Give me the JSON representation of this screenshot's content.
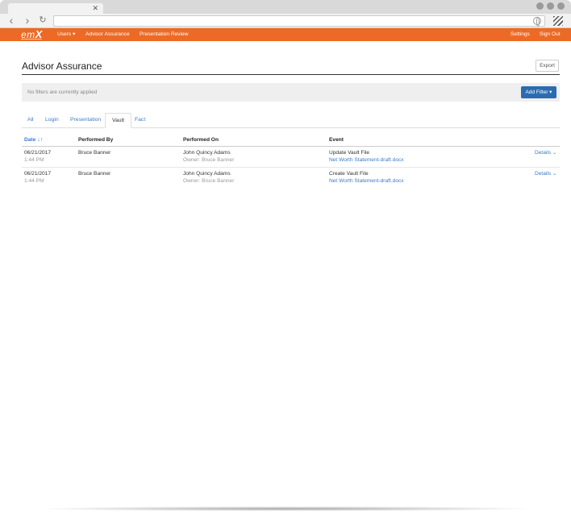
{
  "browser": {
    "tab_close": "✕",
    "url": ""
  },
  "header": {
    "logo_prefix": "em",
    "logo_suffix": "X",
    "nav": [
      {
        "label": "Users ▾"
      },
      {
        "label": "Advisor Assurance"
      },
      {
        "label": "Presentation Review"
      }
    ],
    "settings_label": "Settings",
    "signout_label": "Sign Out",
    "accent_color": "#ec6a25"
  },
  "page": {
    "title": "Advisor Assurance",
    "export_label": "Export"
  },
  "filters": {
    "status_text": "No filters are currently applied",
    "add_filter_label": "Add Filter ▾"
  },
  "tabs": [
    {
      "label": "All",
      "active": false
    },
    {
      "label": "Login",
      "active": false
    },
    {
      "label": "Presentation",
      "active": false
    },
    {
      "label": "Vault",
      "active": true
    },
    {
      "label": "Fact",
      "active": false
    }
  ],
  "table": {
    "columns": [
      "Date",
      "Performed By",
      "Performed On",
      "Event"
    ],
    "sort_icon": "↓↑",
    "rows": [
      {
        "date": "06/21/2017",
        "time": "1:44 PM",
        "performed_by": "Bruce Banner",
        "performed_on": "John Quincy Adams",
        "owner": "Owner: Bruce Banner",
        "event": "Update Vault File",
        "file": "Net Worth Statement-draft.docx",
        "details_label": "Details ⌄"
      },
      {
        "date": "06/21/2017",
        "time": "1:44 PM",
        "performed_by": "Bruce Banner",
        "performed_on": "John Quincy Adams",
        "owner": "Owner: Bruce Banner",
        "event": "Create Vault File",
        "file": "Net Worth Statement-draft.docx",
        "details_label": "Details ⌄"
      }
    ]
  }
}
